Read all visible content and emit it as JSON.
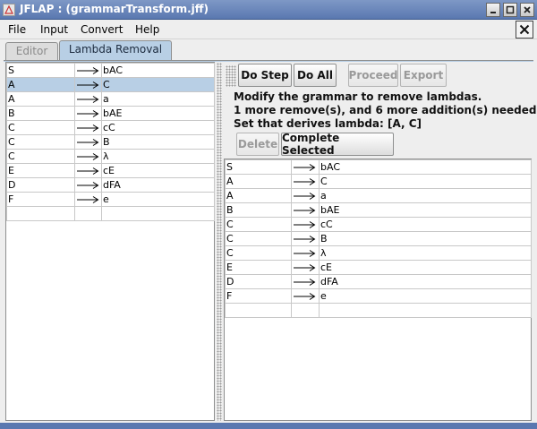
{
  "window": {
    "title": "JFLAP : (grammarTransform.jff)",
    "buttons": [
      "minimize",
      "maximize",
      "close"
    ]
  },
  "menu": {
    "items": [
      "File",
      "Input",
      "Convert",
      "Help"
    ]
  },
  "tabs": [
    {
      "label": "Editor",
      "active": false
    },
    {
      "label": "Lambda Removal",
      "active": true
    }
  ],
  "left_grammar": {
    "rows": [
      {
        "lhs": "S",
        "rhs": "bAC"
      },
      {
        "lhs": "A",
        "rhs": "C"
      },
      {
        "lhs": "A",
        "rhs": "a"
      },
      {
        "lhs": "B",
        "rhs": "bAE"
      },
      {
        "lhs": "C",
        "rhs": "cC"
      },
      {
        "lhs": "C",
        "rhs": "B"
      },
      {
        "lhs": "C",
        "rhs": "λ"
      },
      {
        "lhs": "E",
        "rhs": "cE"
      },
      {
        "lhs": "D",
        "rhs": "dFA"
      },
      {
        "lhs": "F",
        "rhs": "e"
      },
      {
        "lhs": "",
        "rhs": ""
      }
    ],
    "selected_row": 1
  },
  "toolbar": {
    "do_step": "Do Step",
    "do_all": "Do All",
    "proceed": "Proceed",
    "export": "Export"
  },
  "info": {
    "line1": "Modify the grammar to remove lambdas.",
    "line2": "1 more remove(s), and 6 more addition(s) needed.",
    "line3": "Set that derives lambda: [A, C]"
  },
  "actions": {
    "delete": "Delete",
    "complete_selected": "Complete Selected"
  },
  "right_grammar": {
    "rows": [
      {
        "lhs": "S",
        "rhs": "bAC"
      },
      {
        "lhs": "A",
        "rhs": "C"
      },
      {
        "lhs": "A",
        "rhs": "a"
      },
      {
        "lhs": "B",
        "rhs": "bAE"
      },
      {
        "lhs": "C",
        "rhs": "cC"
      },
      {
        "lhs": "C",
        "rhs": "B"
      },
      {
        "lhs": "C",
        "rhs": "λ"
      },
      {
        "lhs": "E",
        "rhs": "cE"
      },
      {
        "lhs": "D",
        "rhs": "dFA"
      },
      {
        "lhs": "F",
        "rhs": "e"
      },
      {
        "lhs": "",
        "rhs": ""
      }
    ]
  },
  "colors": {
    "title_bar": "#5a78b0",
    "selection": "#b8cfe5",
    "active_tab": "#b8cfe5"
  }
}
